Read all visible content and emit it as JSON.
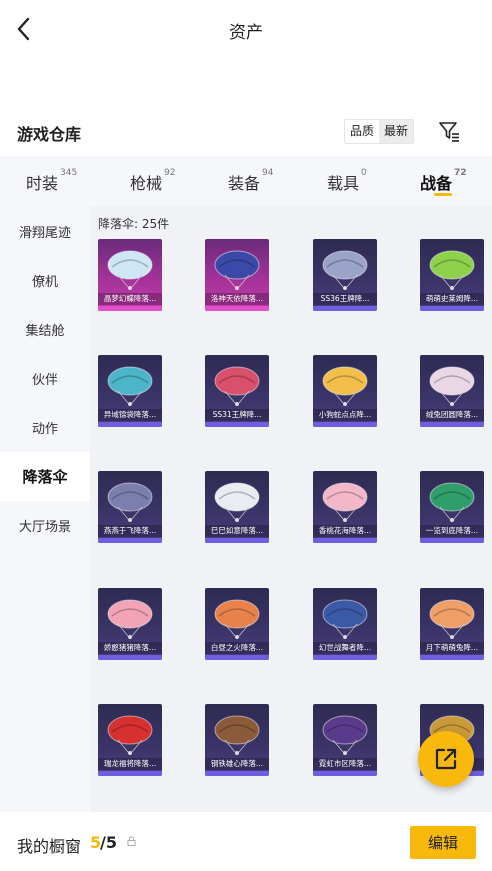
{
  "header": {
    "title": "资产"
  },
  "section": {
    "title": "游戏仓库"
  },
  "sort": {
    "options": [
      "品质",
      "最新"
    ]
  },
  "tabs": [
    {
      "label": "时装",
      "count": "345"
    },
    {
      "label": "枪械",
      "count": "92"
    },
    {
      "label": "装备",
      "count": "94"
    },
    {
      "label": "载具",
      "count": "0"
    },
    {
      "label": "战备",
      "count": "72"
    }
  ],
  "sidebar": {
    "items": [
      "滑翔尾迹",
      "僚机",
      "集结舱",
      "伙伴",
      "动作",
      "降落伞",
      "大厅场景"
    ]
  },
  "grid": {
    "count_label": "降落伞: 25件",
    "items": [
      {
        "name": "晶梦幻蝶降落...",
        "rarity": "pink",
        "color": "#cfe6f5"
      },
      {
        "name": "洛神天依降落...",
        "rarity": "pink",
        "color": "#3b4aa8"
      },
      {
        "name": "SS36王牌降...",
        "rarity": "purple",
        "color": "#9aa3c8"
      },
      {
        "name": "萌萌史莱姆降...",
        "rarity": "purple",
        "color": "#8ed14a"
      },
      {
        "name": "异域锦袋降落...",
        "rarity": "purple",
        "color": "#4bb6c9"
      },
      {
        "name": "SS31王牌降...",
        "rarity": "purple",
        "color": "#d9506a"
      },
      {
        "name": "小狗蛇点点降...",
        "rarity": "purple",
        "color": "#f1bf4a"
      },
      {
        "name": "绒兔团圆降落...",
        "rarity": "purple",
        "color": "#ead7e6"
      },
      {
        "name": "燕燕于飞降落...",
        "rarity": "purple",
        "color": "#7a7fae"
      },
      {
        "name": "巳巳如意降落...",
        "rarity": "purple",
        "color": "#e9edf1"
      },
      {
        "name": "香桃花海降落...",
        "rarity": "purple",
        "color": "#f3b7c9"
      },
      {
        "name": "一览到底降落...",
        "rarity": "purple",
        "color": "#2f9e6a"
      },
      {
        "name": "娇憨猪猪降落...",
        "rarity": "purple",
        "color": "#f2a3b6"
      },
      {
        "name": "白昼之火降落...",
        "rarity": "purple",
        "color": "#e8824a"
      },
      {
        "name": "幻世战舞者降...",
        "rarity": "purple",
        "color": "#3a5aa8"
      },
      {
        "name": "月下萌萌兔降...",
        "rarity": "purple",
        "color": "#f0a066"
      },
      {
        "name": "瑞龙福将降落...",
        "rarity": "purple",
        "color": "#d6302f"
      },
      {
        "name": "钢铁雄心降落...",
        "rarity": "purple",
        "color": "#8a5a3a"
      },
      {
        "name": "霓虹市区降落...",
        "rarity": "purple",
        "color": "#5a3a8a"
      },
      {
        "name": "",
        "rarity": "purple",
        "color": "#c99a3a"
      }
    ]
  },
  "footer": {
    "window_label": "我的橱窗",
    "count_current": "5",
    "count_total": "/5",
    "edit_label": "编辑"
  },
  "colors": {
    "accent": "#f8b90c",
    "card_bg": "#3b3468",
    "card_bar": "#6e5ee0",
    "card_bar_pink": "#e14fc9"
  }
}
